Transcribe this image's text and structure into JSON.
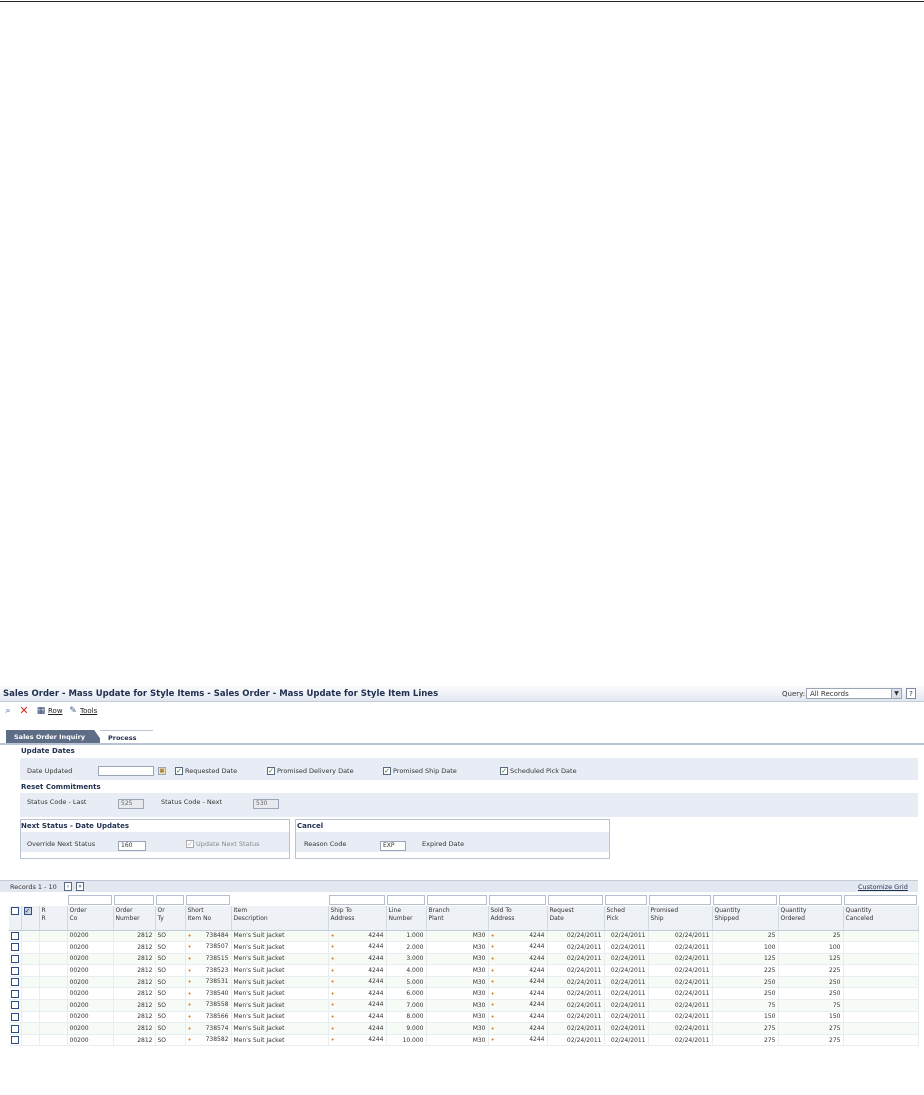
{
  "app": {
    "title": "Sales Order - Mass Update for Style Items - Sales Order - Mass Update for Style Item Lines",
    "query_label": "Query:",
    "query_value": "All Records",
    "help_glyph": "?"
  },
  "toolbar": {
    "row_label": "Row",
    "tools_label": "Tools"
  },
  "tabs": [
    {
      "label": "Sales Order Inquiry",
      "active": false
    },
    {
      "label": "Process",
      "active": true
    }
  ],
  "update_dates": {
    "heading": "Update Dates",
    "date_updated_label": "Date Updated",
    "date_updated_value": "",
    "checkboxes": [
      {
        "label": "Requested Date",
        "checked": true
      },
      {
        "label": "Promised Delivery Date",
        "checked": true
      },
      {
        "label": "Promised Ship Date",
        "checked": true
      },
      {
        "label": "Scheduled Pick Date",
        "checked": true
      }
    ]
  },
  "reset_commitments": {
    "heading": "Reset Commitments",
    "status_last_label": "Status Code - Last",
    "status_last_value": "525",
    "status_next_label": "Status Code - Next",
    "status_next_value": "530"
  },
  "next_status": {
    "heading": "Next Status - Date Updates",
    "override_label": "Override Next Status",
    "override_value": "160",
    "update_next_label": "Update Next Status",
    "update_next_checked": true
  },
  "cancel": {
    "heading": "Cancel",
    "reason_label": "Reason Code",
    "reason_value": "EXP",
    "expired_label": "Expired Date"
  },
  "grid": {
    "records_label": "Records 1 - 10",
    "customize_label": "Customize Grid",
    "columns": [
      "",
      "",
      "R\nR",
      "Order\nCo",
      "Order\nNumber",
      "Or\nTy",
      "Short\nItem No",
      "Item\nDescription",
      "Ship To\nAddress",
      "Line\nNumber",
      "Branch\nPlant",
      "Sold To\nAddress",
      "Request\nDate",
      "Sched\nPick",
      "Promised\nShip",
      "Quantity\nShipped",
      "Quantity\nOrdered",
      "Quantity\nCanceled"
    ],
    "rows": [
      {
        "co": "00200",
        "order": "2812",
        "ty": "SO",
        "item": "738484",
        "desc": "Men's Suit Jacket",
        "ship_to": "4244",
        "line": "1.000",
        "branch": "M30",
        "sold_to": "4244",
        "req": "02/24/2011",
        "pick": "02/24/2011",
        "ship": "02/24/2011",
        "shipped": "25",
        "ordered": "25"
      },
      {
        "co": "00200",
        "order": "2812",
        "ty": "SO",
        "item": "738507",
        "desc": "Men's Suit Jacket",
        "ship_to": "4244",
        "line": "2.000",
        "branch": "M30",
        "sold_to": "4244",
        "req": "02/24/2011",
        "pick": "02/24/2011",
        "ship": "02/24/2011",
        "shipped": "100",
        "ordered": "100"
      },
      {
        "co": "00200",
        "order": "2812",
        "ty": "SO",
        "item": "738515",
        "desc": "Men's Suit Jacket",
        "ship_to": "4244",
        "line": "3.000",
        "branch": "M30",
        "sold_to": "4244",
        "req": "02/24/2011",
        "pick": "02/24/2011",
        "ship": "02/24/2011",
        "shipped": "125",
        "ordered": "125"
      },
      {
        "co": "00200",
        "order": "2812",
        "ty": "SO",
        "item": "738523",
        "desc": "Men's Suit Jacket",
        "ship_to": "4244",
        "line": "4.000",
        "branch": "M30",
        "sold_to": "4244",
        "req": "02/24/2011",
        "pick": "02/24/2011",
        "ship": "02/24/2011",
        "shipped": "225",
        "ordered": "225"
      },
      {
        "co": "00200",
        "order": "2812",
        "ty": "SO",
        "item": "738531",
        "desc": "Men's Suit Jacket",
        "ship_to": "4244",
        "line": "5.000",
        "branch": "M30",
        "sold_to": "4244",
        "req": "02/24/2011",
        "pick": "02/24/2011",
        "ship": "02/24/2011",
        "shipped": "250",
        "ordered": "250"
      },
      {
        "co": "00200",
        "order": "2812",
        "ty": "SO",
        "item": "738540",
        "desc": "Men's Suit Jacket",
        "ship_to": "4244",
        "line": "6.000",
        "branch": "M30",
        "sold_to": "4244",
        "req": "02/24/2011",
        "pick": "02/24/2011",
        "ship": "02/24/2011",
        "shipped": "250",
        "ordered": "250"
      },
      {
        "co": "00200",
        "order": "2812",
        "ty": "SO",
        "item": "738558",
        "desc": "Men's Suit Jacket",
        "ship_to": "4244",
        "line": "7.000",
        "branch": "M30",
        "sold_to": "4244",
        "req": "02/24/2011",
        "pick": "02/24/2011",
        "ship": "02/24/2011",
        "shipped": "75",
        "ordered": "75"
      },
      {
        "co": "00200",
        "order": "2812",
        "ty": "SO",
        "item": "738566",
        "desc": "Men's Suit Jacket",
        "ship_to": "4244",
        "line": "8.000",
        "branch": "M30",
        "sold_to": "4244",
        "req": "02/24/2011",
        "pick": "02/24/2011",
        "ship": "02/24/2011",
        "shipped": "150",
        "ordered": "150"
      },
      {
        "co": "00200",
        "order": "2812",
        "ty": "SO",
        "item": "738574",
        "desc": "Men's Suit Jacket",
        "ship_to": "4244",
        "line": "9.000",
        "branch": "M30",
        "sold_to": "4244",
        "req": "02/24/2011",
        "pick": "02/24/2011",
        "ship": "02/24/2011",
        "shipped": "275",
        "ordered": "275"
      },
      {
        "co": "00200",
        "order": "2812",
        "ty": "SO",
        "item": "738582",
        "desc": "Men's Suit Jacket",
        "ship_to": "4244",
        "line": "10.000",
        "branch": "M30",
        "sold_to": "4244",
        "req": "02/24/2011",
        "pick": "02/24/2011",
        "ship": "02/24/2011",
        "shipped": "275",
        "ordered": "275"
      }
    ]
  }
}
